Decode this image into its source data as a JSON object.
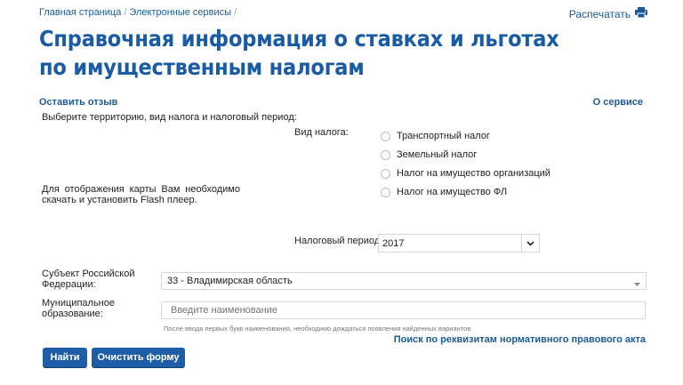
{
  "breadcrumb": [
    "Главная страница",
    "Электронные сервисы"
  ],
  "print_label": "Распечатать",
  "page_title": "Справочная информация о ставках и льготах по имущественным налогам",
  "feedback_link": "Оставить отзыв",
  "about_link": "О сервисе",
  "instruction": "Выберите территорию, вид налога и налоговый период:",
  "flash_notice": "Для отображения карты Вам необходимо скачать и установить Flash плеер.",
  "tax_type": {
    "label": "Вид налога:",
    "options": [
      "Транспортный налог",
      "Земельный налог",
      "Налог на имущество организаций",
      "Налог на имущество ФЛ"
    ]
  },
  "tax_period": {
    "label": "Налоговый период:",
    "value": "2017"
  },
  "subject": {
    "label": "Субъект Российской Федерации:",
    "value": "33 - Владимирская область"
  },
  "municipality": {
    "label": "Муниципальное образование:",
    "placeholder": "Введите наименование",
    "hint": "После ввода первых букв наименования, необходимо дождаться появления найденных вариантов."
  },
  "requisites_link": "Поиск по реквизитам нормативного правового акта",
  "buttons": {
    "find": "Найти",
    "clear": "Очистить форму"
  },
  "colors": {
    "accent": "#1e5ea8",
    "title": "#1a5ba6",
    "link": "#1b5a96"
  }
}
